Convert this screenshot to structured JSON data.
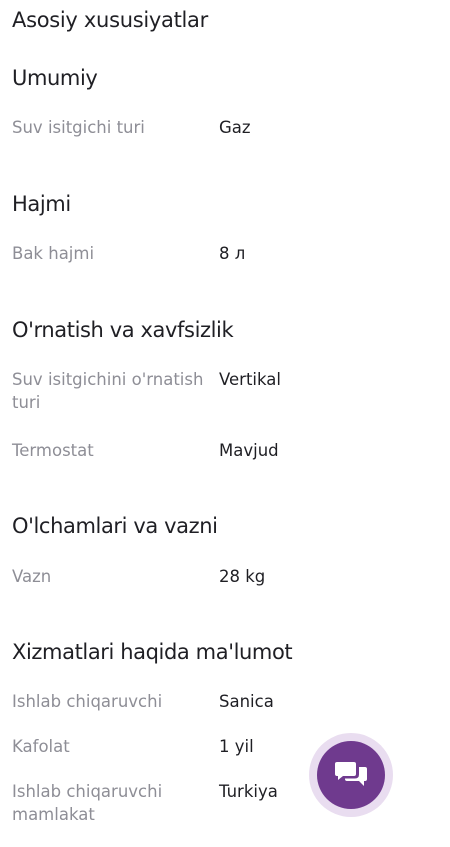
{
  "page": {
    "title": "Asosiy xususiyatlar"
  },
  "sections": [
    {
      "title": "Umumiy",
      "rows": [
        {
          "key": "Suv isitgichi turi",
          "value": "Gaz"
        }
      ]
    },
    {
      "title": "Hajmi",
      "rows": [
        {
          "key": "Bak hajmi",
          "value": "8 л"
        }
      ]
    },
    {
      "title": "O'rnatish va xavfsizlik",
      "rows": [
        {
          "key": "Suv isitgichini o'rnatish turi",
          "value": "Vertikal"
        },
        {
          "key": "Termostat",
          "value": "Mavjud"
        }
      ]
    },
    {
      "title": "O'lchamlari va vazni",
      "rows": [
        {
          "key": "Vazn",
          "value": "28 kg"
        }
      ]
    },
    {
      "title": "Xizmatlari haqida ma'lumot",
      "rows": [
        {
          "key": "Ishlab chiqaruvchi",
          "value": "Sanica"
        },
        {
          "key": "Kafolat",
          "value": "1 yil"
        },
        {
          "key": "Ishlab chiqaruvchi mamlakat",
          "value": "Turkiya"
        }
      ]
    }
  ],
  "chat_button": {
    "icon": "chat-bubbles-icon",
    "color": "#6f3a8e",
    "ring_color": "#e9ddf0"
  }
}
